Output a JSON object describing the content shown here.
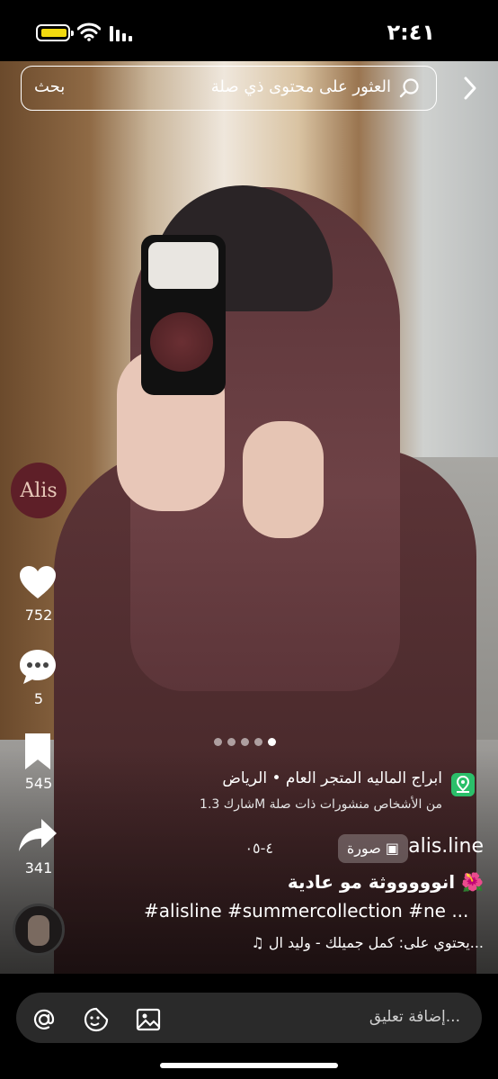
{
  "status_bar": {
    "time": "٢:٤١",
    "battery_color": "#f2d90f"
  },
  "search": {
    "placeholder": "العثور على محتوى ذي صلة",
    "button_label": "بحث"
  },
  "profile": {
    "logo_text": "Alis"
  },
  "actions": {
    "likes": "752",
    "comments": "5",
    "saves": "545",
    "shares": "341"
  },
  "carousel": {
    "pages": 5,
    "active_index": 4
  },
  "location": {
    "title": "ابراج الماليه المتجر العام • الرياض",
    "subtitle": "شارك 1.3M من الأشخاص منشورات ذات صلة"
  },
  "post": {
    "username": "alis.line",
    "media_tag": "صورة",
    "date": "٤-٠٥",
    "caption": "انوووووثة مو عادية 🌺",
    "hashtags": "#alisline #summercollection #ne ...",
    "music": "♫ يحتوي على: كمل جميلك - وليد ال..."
  },
  "comment_bar": {
    "placeholder": "إضافة تعليق..."
  },
  "colors": {
    "accent_green": "#2bbf6a",
    "avatar_bg": "#5e1f28"
  }
}
